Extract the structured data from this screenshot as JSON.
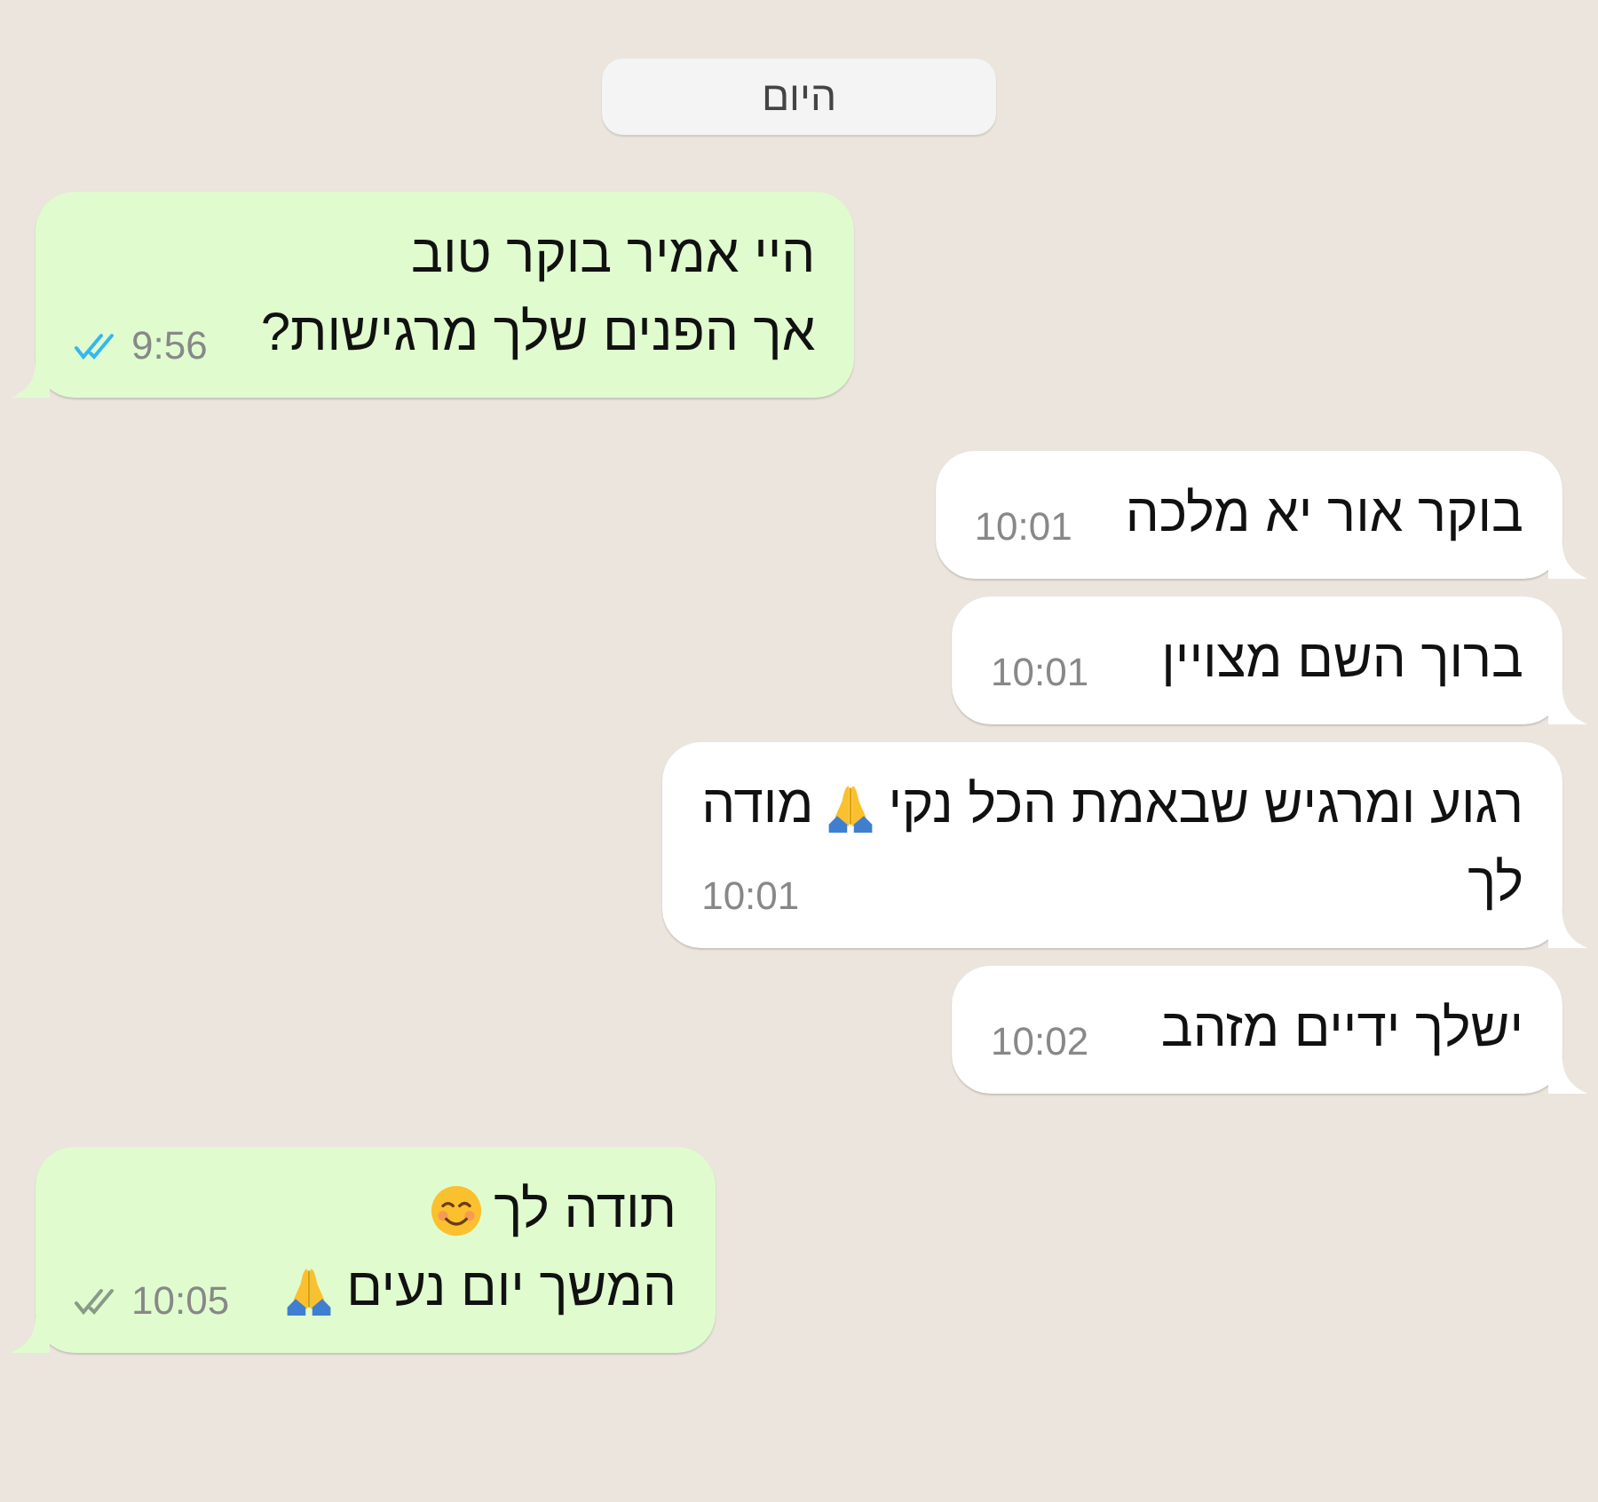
{
  "date_pill": "היום",
  "messages": [
    {
      "kind": "outgoing",
      "time": "9:56",
      "read": true,
      "lines": [
        [
          {
            "kind": "text",
            "text": "היי אמיר בוקר טוב"
          }
        ],
        [
          {
            "kind": "text",
            "text": "אך הפנים שלך מרגישות?"
          }
        ]
      ]
    },
    {
      "kind": "incoming",
      "time": "10:01",
      "lines": [
        [
          {
            "kind": "text",
            "text": "בוקר אור יא מלכה"
          }
        ]
      ]
    },
    {
      "kind": "incoming",
      "time": "10:01",
      "lines": [
        [
          {
            "kind": "text",
            "text": "ברוך השם מצויין"
          }
        ]
      ]
    },
    {
      "kind": "incoming",
      "time": "10:01",
      "lines": [
        [
          {
            "kind": "text",
            "text": "רגוע ומרגיש שבאמת הכל נקי"
          },
          {
            "kind": "pray"
          },
          {
            "kind": "text",
            "text": "מודה"
          }
        ],
        [
          {
            "kind": "text",
            "text": "לך"
          }
        ]
      ]
    },
    {
      "kind": "incoming",
      "time": "10:02",
      "lines": [
        [
          {
            "kind": "text",
            "text": "ישלך ידיים מזהב"
          }
        ]
      ]
    },
    {
      "kind": "outgoing",
      "time": "10:05",
      "read": false,
      "lines": [
        [
          {
            "kind": "text",
            "text": "תודה לך"
          },
          {
            "kind": "smile"
          }
        ],
        [
          {
            "kind": "text",
            "text": "המשך יום נעים"
          },
          {
            "kind": "pray"
          }
        ]
      ]
    }
  ]
}
